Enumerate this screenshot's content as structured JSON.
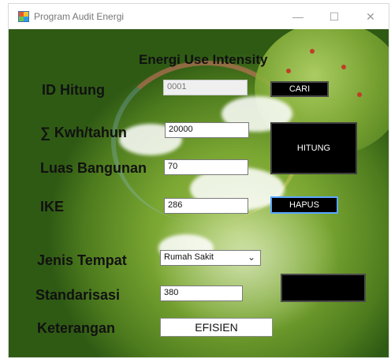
{
  "window": {
    "title": "Program Audit Energi",
    "controls": {
      "minimize": "—",
      "maximize": "☐",
      "close": "✕"
    }
  },
  "form": {
    "heading": "Energi Use Intensity",
    "labels": {
      "id_hitung": "ID Hitung",
      "kwh_tahun": "∑ Kwh/tahun",
      "luas_bangunan": "Luas Bangunan",
      "ike": "IKE",
      "jenis_tempat": "Jenis Tempat",
      "standarisasi": "Standarisasi",
      "keterangan": "Keterangan"
    },
    "fields": {
      "id_hitung": "0001",
      "kwh_tahun": "20000",
      "luas_bangunan": "70",
      "ike": "286",
      "jenis_tempat_selected": "Rumah Sakit",
      "standarisasi": "380",
      "keterangan": "EFISIEN"
    },
    "buttons": {
      "cari": "CARI",
      "hitung": "HITUNG",
      "hapus": "HAPUS",
      "blank": ""
    }
  }
}
